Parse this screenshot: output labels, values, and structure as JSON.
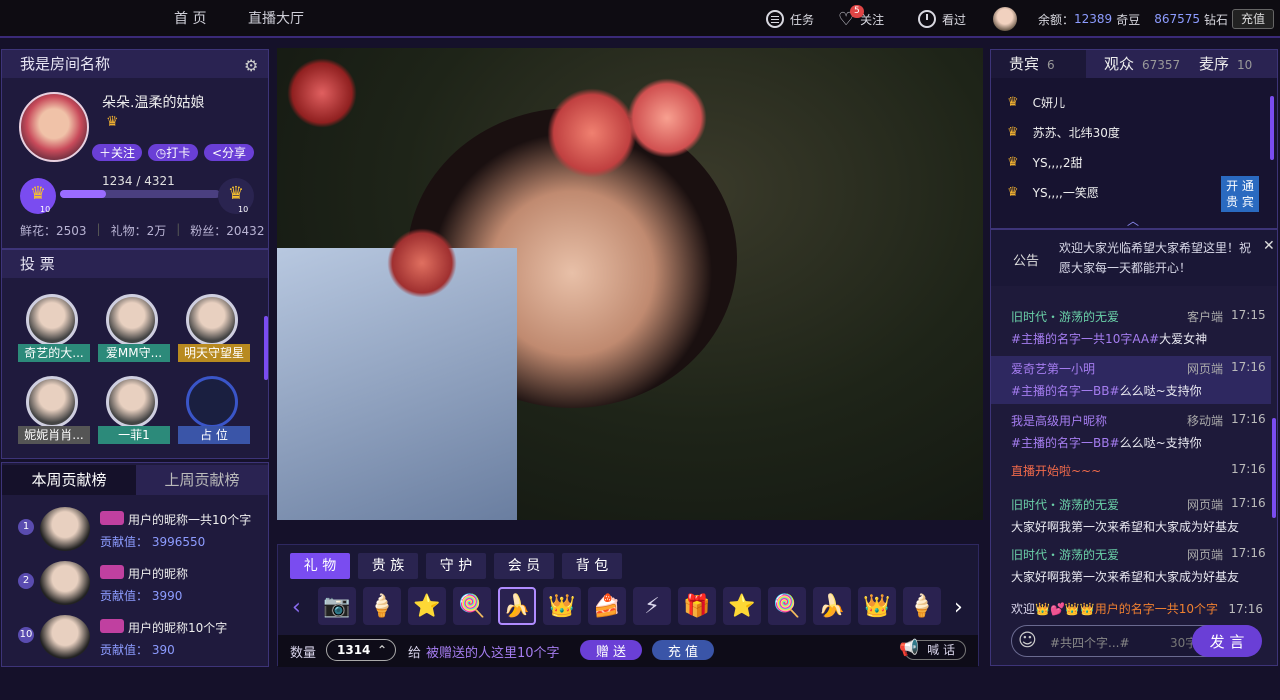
{
  "nav": {
    "home": "首 页",
    "hall": "直播大厅"
  },
  "top": {
    "tasks": "任务",
    "follow": "关注",
    "follow_badge": "5",
    "watched": "看过",
    "balance_label": "余额：",
    "balance_qiyi": "12389",
    "qiyi_unit": "奇豆",
    "diamonds": "867575",
    "diamond_unit": "钻石",
    "recharge": "充值"
  },
  "room": {
    "title": "我是房间名称",
    "anchor": "朵朵.温柔的姑娘",
    "follow": "关注",
    "checkin": "打卡",
    "share": "分享",
    "progress": "1234 / 4321",
    "progress_value": 0.29,
    "level_left": "10",
    "level_right": "10",
    "stats": [
      "鲜花：2503",
      "礼物：2万",
      "粉丝：20432"
    ]
  },
  "vote": {
    "title": "投 票",
    "items": [
      {
        "name": "奇艺的大...",
        "style": "teal"
      },
      {
        "name": "爱MM守...",
        "style": "teal"
      },
      {
        "name": "明天守望星",
        "style": "gold"
      },
      {
        "name": "妮妮肖肖...",
        "style": "gray"
      },
      {
        "name": "一菲1",
        "style": "teal"
      },
      {
        "name": "占 位",
        "style": "blue"
      }
    ]
  },
  "rank": {
    "tab_this": "本周贡献榜",
    "tab_last": "上周贡献榜",
    "items": [
      {
        "n": "1",
        "name": "用户的昵称一共10个字",
        "value": "贡献值： 3996550"
      },
      {
        "n": "2",
        "name": "用户的昵称",
        "value": "贡献值： 3990"
      },
      {
        "n": "10",
        "name": "用户的昵称10个字",
        "value": "贡献值： 390"
      }
    ]
  },
  "gifts": {
    "tabs": [
      "礼 物",
      "贵 族",
      "守 护",
      "会 员",
      "背 包"
    ],
    "icons": [
      "📷",
      "🍦",
      "⭐",
      "🍭",
      "🍌",
      "👑",
      "🍰",
      "⚡",
      "🎁",
      "⭐",
      "🍭",
      "🍌",
      "👑",
      "🍦"
    ],
    "qty_label": "数量",
    "qty": "1314",
    "give": "给",
    "target": "被赠送的人这里10个字",
    "send": "赠 送",
    "recharge": "充 值",
    "shout": "喊 话"
  },
  "right": {
    "tabs": [
      {
        "label": "贵宾",
        "count": "6"
      },
      {
        "label": "观众",
        "count": "67357"
      },
      {
        "label": "麦序",
        "count": "10"
      }
    ],
    "vips": [
      "C妍儿",
      "苏苏、北纬30度",
      "YS,,,,2甜",
      "YS,,,,一笑愿"
    ],
    "open_vip": [
      "开 通",
      "贵 宾"
    ],
    "notice_label": "公告",
    "notice": "欢迎大家光临希望大家希望这里！祝愿大家每一天都能开心！",
    "chat": [
      {
        "name": "旧时代・游荡的无爱",
        "src": "客户端",
        "time": "17:15",
        "msg": "#主播的名字一共10字AA#",
        "tail": "大爱女神"
      },
      {
        "name": "爱奇艺第一小明",
        "src": "网页端",
        "time": "17:16",
        "msg": "#主播的名字一BB#",
        "tail": "么么哒~支持你"
      },
      {
        "name": "我是高级用户昵称",
        "src": "移动端",
        "time": "17:16",
        "msg": "#主播的名字一BB#",
        "tail": "么么哒~支持你"
      },
      {
        "name": "直播开始啦~~~",
        "src": "",
        "time": "17:16",
        "msg": "",
        "tail": ""
      },
      {
        "name": "旧时代・游荡的无爱",
        "src": "网页端",
        "time": "17:16",
        "msg": "",
        "tail": "大家好啊我第一次来希望和大家成为好基友"
      },
      {
        "name": "旧时代・游荡的无爱",
        "src": "网页端",
        "time": "17:16",
        "msg": "",
        "tail": "大家好啊我第一次来希望和大家成为好基友"
      }
    ],
    "welcome": "欢迎",
    "welcome_user": "用户的名字一共10个字",
    "welcome_time": "17:16",
    "input_placeholder": "#共四个字...#",
    "input_count": "30字",
    "send": "发 言"
  },
  "colors": {
    "accent": "#7a4cf0",
    "bg": "#15112a",
    "panel": "#1f1a3d"
  }
}
